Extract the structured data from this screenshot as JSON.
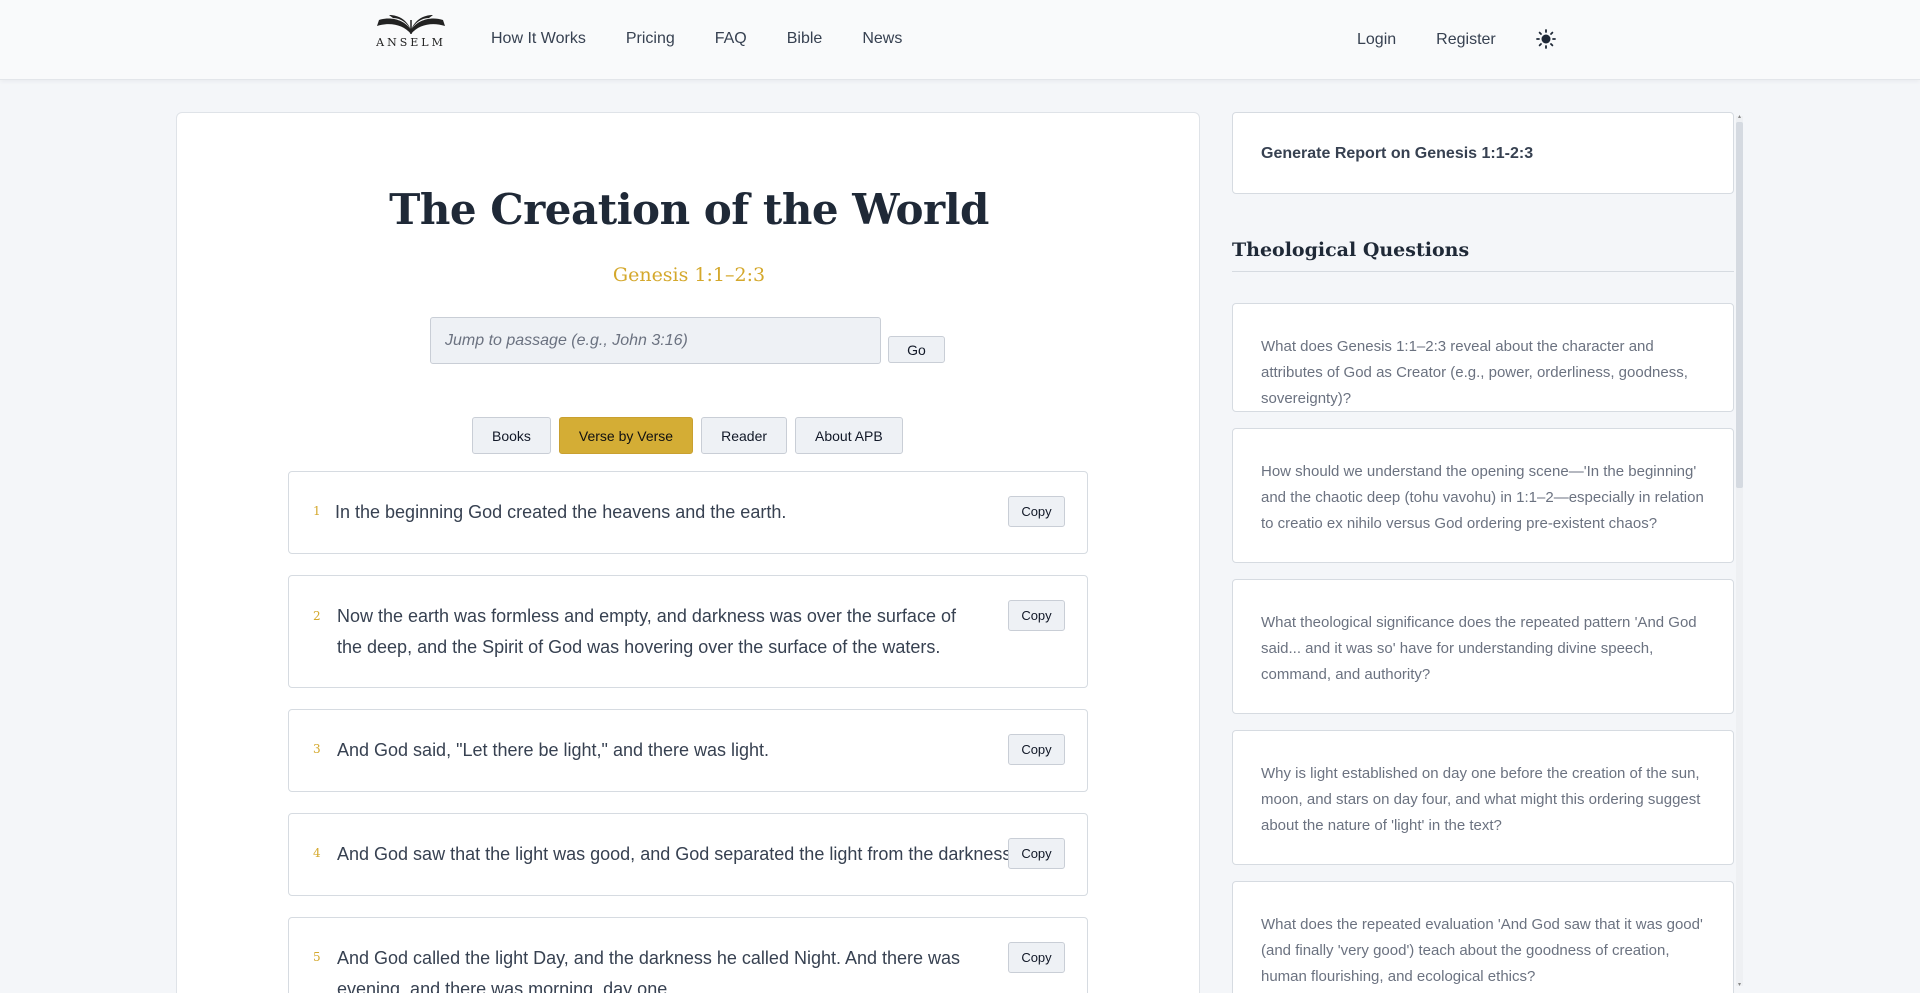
{
  "header": {
    "logo_text": "ANSELM",
    "nav": [
      "How It Works",
      "Pricing",
      "FAQ",
      "Bible",
      "News"
    ],
    "login_label": "Login",
    "register_label": "Register"
  },
  "main": {
    "title": "The Creation of the World",
    "passage": "Genesis 1:1–2:3",
    "jump_placeholder": "Jump to passage (e.g., John 3:16)",
    "go_label": "Go",
    "tabs": [
      "Books",
      "Verse by Verse",
      "Reader",
      "About APB"
    ],
    "active_tab": "Verse by Verse",
    "copy_label": "Copy",
    "verses": [
      {
        "num": "1",
        "text": "In the beginning God created the heavens and the earth."
      },
      {
        "num": "2",
        "text": "Now the earth was formless and empty, and darkness was over the surface of the deep, and the Spirit of God was hovering over the surface of the waters."
      },
      {
        "num": "3",
        "text": "And God said, \"Let there be light,\" and there was light."
      },
      {
        "num": "4",
        "text": "And God saw that the light was good, and God separated the light from the darkness."
      },
      {
        "num": "5",
        "text": "And God called the light Day, and the darkness he called Night. And there was evening, and there was morning, day one."
      }
    ]
  },
  "sidebar": {
    "report_label": "Generate Report on Genesis 1:1-2:3",
    "section_title": "Theological Questions",
    "questions": [
      "What does Genesis 1:1–2:3 reveal about the character and attributes of God as Creator (e.g., power, orderliness, goodness, sovereignty)?",
      "How should we understand the opening scene—'In the beginning' and the chaotic deep (tohu vavohu) in 1:1–2—especially in relation to creatio ex nihilo versus God ordering pre-existent chaos?",
      "What theological significance does the repeated pattern 'And God said... and it was so' have for understanding divine speech, command, and authority?",
      "Why is light established on day one before the creation of the sun, moon, and stars on day four, and what might this ordering suggest about the nature of 'light' in the text?",
      "What does the repeated evaluation 'And God saw that it was good' (and finally 'very good') teach about the goodness of creation, human flourishing, and ecological ethics?"
    ]
  },
  "colors": {
    "accent_gold": "#d4ad35",
    "verse_number": "#d4a82c",
    "background": "#f4f6f9"
  }
}
